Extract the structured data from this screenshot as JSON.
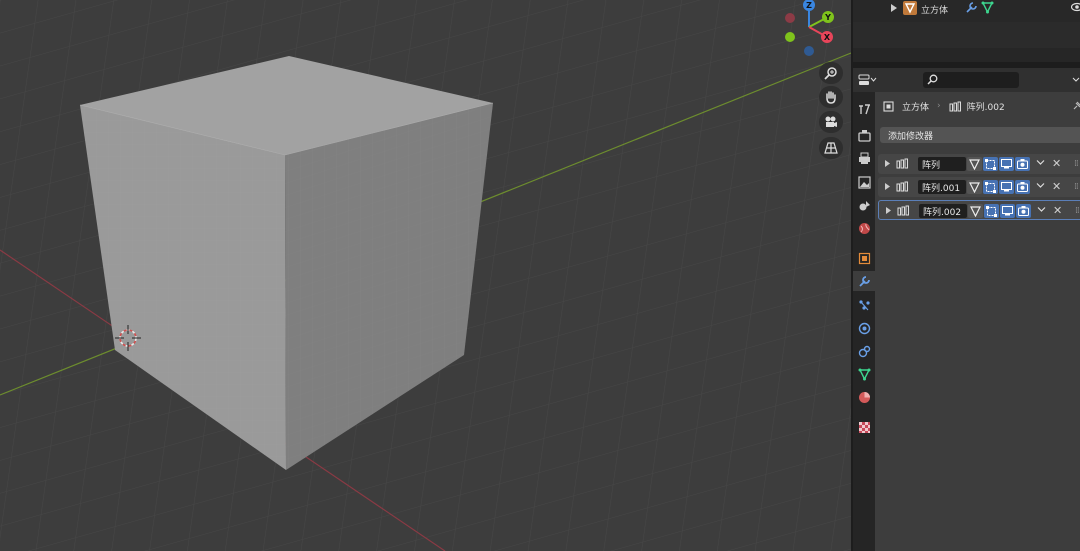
{
  "outliner": {
    "object_name": "立方体"
  },
  "properties": {
    "search": {
      "placeholder": ""
    },
    "context": {
      "object": "立方体",
      "modifier": "阵列.002"
    },
    "add_modifier_label": "添加修改器",
    "modifiers": [
      {
        "name": "阵列",
        "active": false
      },
      {
        "name": "阵列.001",
        "active": false
      },
      {
        "name": "阵列.002",
        "active": true
      }
    ]
  },
  "navigation_gizmo": {
    "z": "Z",
    "y": "Y",
    "x": "X"
  },
  "colors": {
    "accent": "#4772b3",
    "x_axis": "#e8455a",
    "y_axis": "#7fc31c",
    "z_axis": "#3a86e0",
    "viewport_bg": "#3d3d3d"
  }
}
